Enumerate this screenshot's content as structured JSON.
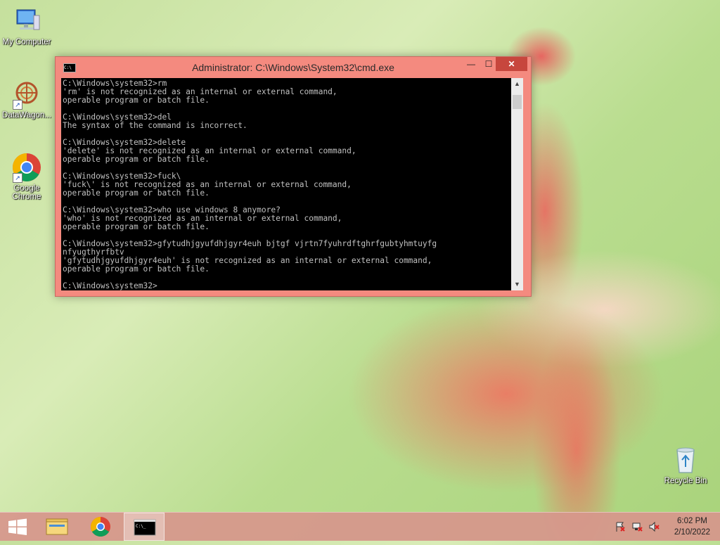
{
  "desktop": {
    "icons": [
      {
        "label": "My Computer"
      },
      {
        "label": "DataWagon..."
      },
      {
        "label": "Google\nChrome"
      },
      {
        "label": "Recycle Bin"
      }
    ]
  },
  "window": {
    "title": "Administrator: C:\\Windows\\System32\\cmd.exe",
    "minimize": "—",
    "maximize": "☐",
    "close": "✕",
    "console_text": "C:\\Windows\\system32>rm\n'rm' is not recognized as an internal or external command,\noperable program or batch file.\n\nC:\\Windows\\system32>del\nThe syntax of the command is incorrect.\n\nC:\\Windows\\system32>delete\n'delete' is not recognized as an internal or external command,\noperable program or batch file.\n\nC:\\Windows\\system32>fuck\\\n'fuck\\' is not recognized as an internal or external command,\noperable program or batch file.\n\nC:\\Windows\\system32>who use windows 8 anymore?\n'who' is not recognized as an internal or external command,\noperable program or batch file.\n\nC:\\Windows\\system32>gfytudhjgyufdhjgyr4euh bjtgf vjrtn7fyuhrdftghrfgubtyhmtuyfg\nnfyugthyrfbtv\n'gfytudhjgyufdhjgyr4euh' is not recognized as an internal or external command,\noperable program or batch file.\n\nC:\\Windows\\system32>"
  },
  "taskbar": {
    "clock_time": "6:02 PM",
    "clock_date": "2/10/2022"
  },
  "colors": {
    "window_frame": "#f48a7f",
    "close_button": "#c7463d",
    "console_bg": "#000000",
    "console_text": "#c0c0c0"
  }
}
